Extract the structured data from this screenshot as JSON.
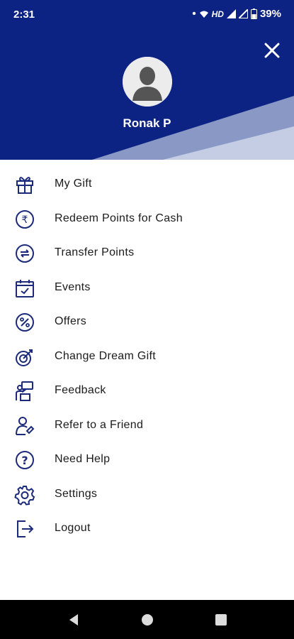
{
  "status_bar": {
    "time": "2:31",
    "network_badge": "HD",
    "battery": "39%"
  },
  "header": {
    "user_name": "Ronak P",
    "close_icon": "close-icon",
    "background_color": "#0c2383"
  },
  "menu": {
    "items": [
      {
        "label": "My Gift",
        "icon": "gift-icon"
      },
      {
        "label": "Redeem Points for Cash",
        "icon": "rupee-icon"
      },
      {
        "label": "Transfer Points",
        "icon": "transfer-icon"
      },
      {
        "label": "Events",
        "icon": "calendar-icon"
      },
      {
        "label": "Offers",
        "icon": "percent-icon"
      },
      {
        "label": "Change Dream Gift",
        "icon": "target-icon"
      },
      {
        "label": "Feedback",
        "icon": "feedback-icon"
      },
      {
        "label": "Refer to a Friend",
        "icon": "refer-icon"
      },
      {
        "label": "Need Help",
        "icon": "help-icon"
      },
      {
        "label": "Settings",
        "icon": "settings-icon"
      },
      {
        "label": "Logout",
        "icon": "logout-icon"
      }
    ]
  },
  "nav_bar": {
    "back": "back-icon",
    "home": "home-icon",
    "recents": "recents-icon"
  }
}
